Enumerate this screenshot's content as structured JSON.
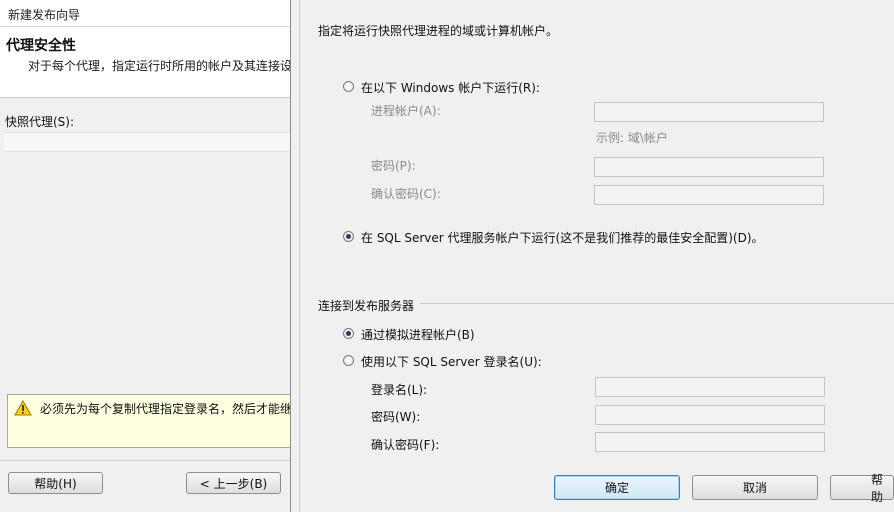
{
  "wizard": {
    "title": "新建发布向导",
    "header_title": "代理安全性",
    "header_subtitle": "对于每个代理，指定运行时所用的帐户及其连接设",
    "agent_label": "快照代理(S):",
    "warning_text": "必须先为每个复制代理指定登录名，然后才能继",
    "help_button": "帮助(H)",
    "prev_button": "< 上一步(B)"
  },
  "dialog": {
    "instruction": "指定将运行快照代理进程的域或计算机帐户。",
    "radio_windows": "在以下 Windows 帐户下运行(R):",
    "process_account_label": "进程帐户(A):",
    "example_text": "示例: 域\\帐户",
    "password_label": "密码(P):",
    "confirm_password_label": "确认密码(C):",
    "radio_sqlagent": "在 SQL Server 代理服务帐户下运行(这不是我们推荐的最佳安全配置)(D)。",
    "connect_group_label": "连接到发布服务器",
    "radio_impersonate": "通过模拟进程帐户(B)",
    "radio_sql_login": "使用以下 SQL Server 登录名(U):",
    "login_label": "登录名(L):",
    "sql_password_label": "密码(W):",
    "sql_confirm_label": "确认密码(F):",
    "ok_button": "确定",
    "cancel_button": "取消",
    "help_button": "帮助"
  }
}
